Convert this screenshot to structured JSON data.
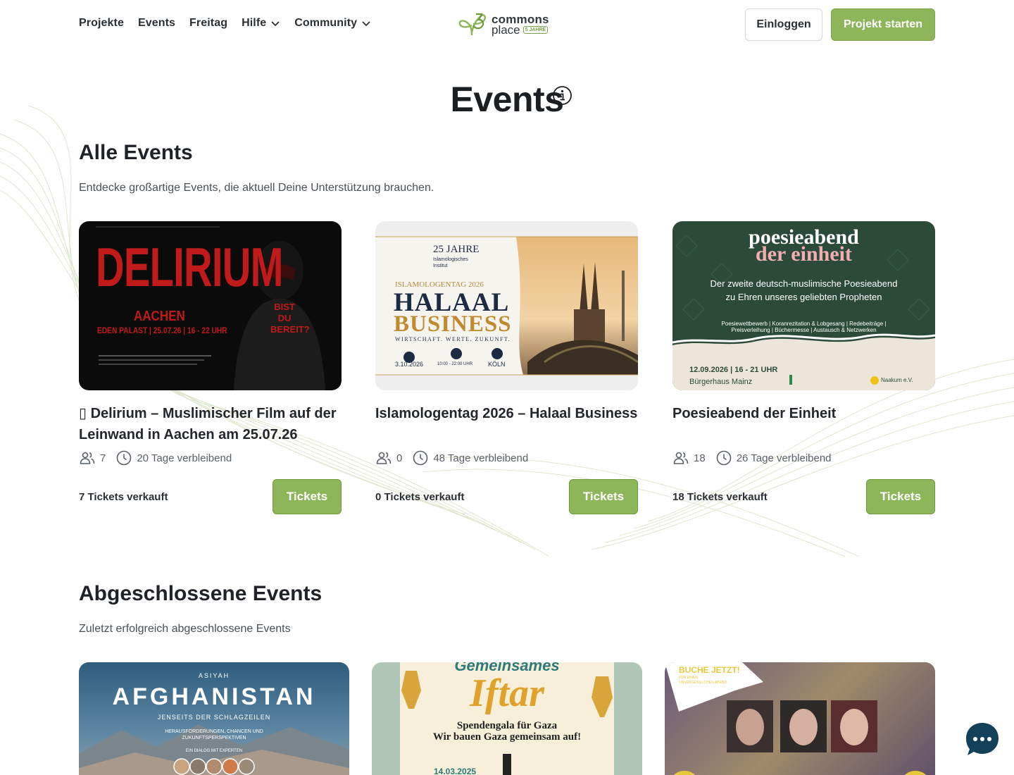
{
  "nav": {
    "links": [
      {
        "label": "Projekte"
      },
      {
        "label": "Events"
      },
      {
        "label": "Freitag"
      },
      {
        "label": "Hilfe"
      },
      {
        "label": "Community"
      }
    ],
    "logo": {
      "line1": "commons",
      "line2": "place",
      "badge": "5 JAHRE"
    },
    "login_label": "Einloggen",
    "start_label": "Projekt starten"
  },
  "page_title": "Events",
  "active": {
    "title": "Alle Events",
    "subtitle": "Entdecke großartige Events, die aktuell Deine Unterstützung brauchen.",
    "cards": [
      {
        "title": "▯ Delirium – Muslimischer Film auf der Leinwand in Aachen am 25.07.26",
        "supporters": "7",
        "remaining": "20 Tage verbleibend",
        "sold": "7 Tickets verkauft",
        "button": "Tickets",
        "poster": {
          "headline": "DELIRIUM",
          "city": "AACHEN",
          "details": "EDEN PALAST | 25.07.26 | 16 - 22 UHR",
          "tagline": "BIST DU BEREIT?"
        }
      },
      {
        "title": "Islamologentag 2026 – Halaal Business",
        "supporters": "0",
        "remaining": "48 Tage verbleibend",
        "sold": "0 Tickets verkauft",
        "button": "Tickets",
        "poster": {
          "jubilee": "25 JAHRE",
          "institute": "Islamologisches Institut",
          "event": "ISLAMOLOGENTAG 2026",
          "line1": "HALAAL",
          "line2": "BUSINESS",
          "tagline": "WIRTSCHAFT. WERTE. ZUKUNFT.",
          "date": "3.10.2026",
          "time": "10:00 - 22:00 UHR",
          "place": "KÖLN"
        }
      },
      {
        "title": "Poesieabend der Einheit",
        "supporters": "18",
        "remaining": "26 Tage verbleibend",
        "sold": "18 Tickets verkauft",
        "button": "Tickets",
        "poster": {
          "line1": "poesieabend",
          "line2": "der einheit",
          "desc1": "Der zweite deutsch-muslimische Poesieabend",
          "desc2": "zu Ehren unseres geliebten Propheten",
          "items1": "Poesiewettbewerb | Koranrezitation & Lobgesang | Redebeiträge |",
          "items2": "Preisverleihung | Büchermesse | Austausch & Netzwerken",
          "date": "12.09.2026 | 16 - 21 UHR",
          "venue": "Bürgerhaus Mainz",
          "org": "Naakum e.V."
        }
      }
    ]
  },
  "completed": {
    "title": "Abgeschlossene Events",
    "subtitle": "Zuletzt erfolgreich abgeschlossene Events",
    "cards": [
      {
        "org": "ASIYAH",
        "headline": "AFGHANISTAN",
        "sub": "JENSEITS DER SCHLAGZEILEN",
        "desc": "HERAUSFORDERUNGEN, CHANCEN UND ZUKUNFTSPERSPEKTIVEN",
        "note": "EIN DIALOG MIT EXPERTEN"
      },
      {
        "top": "Gemeinsames",
        "headline": "Iftar",
        "line1": "Spendengala für Gaza",
        "line2": "Wir bauen Gaza gemeinsam auf!",
        "date": "14.03.2025"
      },
      {
        "badge": "BUCHE JETZT!",
        "badge_sub": "FÜR EINEN UNVERGESSLICHEN ABEND"
      }
    ]
  },
  "colors": {
    "accent": "#8db55a",
    "text": "#1f2327"
  }
}
